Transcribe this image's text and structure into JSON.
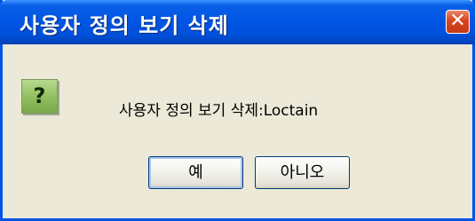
{
  "dialog": {
    "title": "사용자 정의 보기 삭제",
    "close_glyph": "✕",
    "icon_glyph": "?",
    "message": "사용자 정의 보기 삭제:Loctain",
    "yes_label": "예",
    "no_label": "아니오"
  },
  "colors": {
    "titlebar": "#0055e5",
    "window_bg": "#ece9d8",
    "close_button": "#d7451f",
    "question_icon": "#8fbf5d"
  }
}
